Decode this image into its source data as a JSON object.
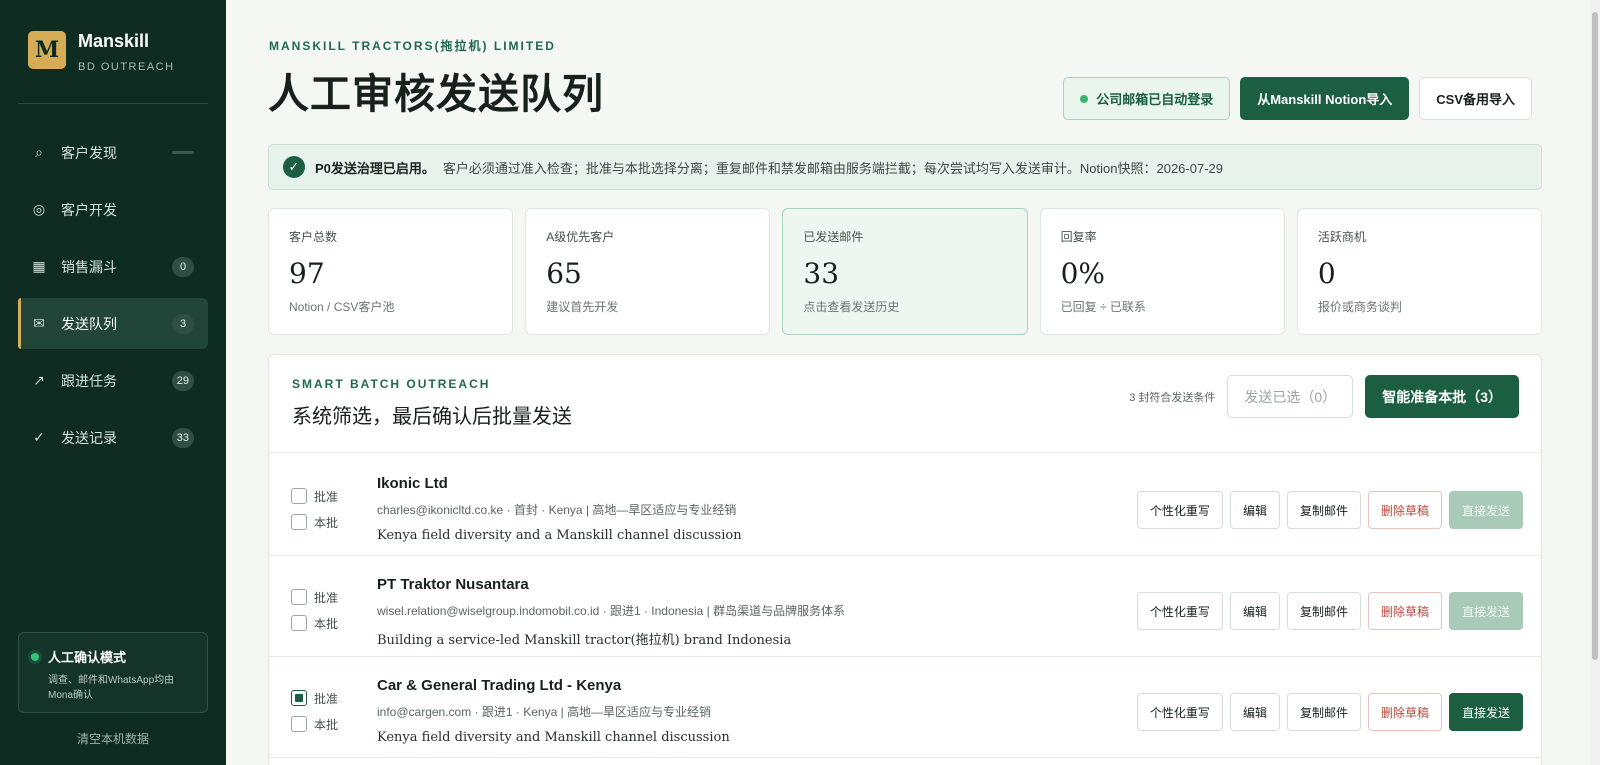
{
  "sidebar": {
    "logo_letter": "M",
    "brand_name": "Manskill",
    "brand_sub": "BD OUTREACH",
    "items": [
      {
        "label": "客户发现",
        "icon": "search-icon",
        "badge": ""
      },
      {
        "label": "客户开发",
        "icon": "target-icon",
        "badge": "0"
      },
      {
        "label": "销售漏斗",
        "icon": "grid-icon",
        "badge": "0"
      },
      {
        "label": "发送队列",
        "icon": "mail-icon",
        "badge": "3"
      },
      {
        "label": "跟进任务",
        "icon": "arrow-up-right-icon",
        "badge": "29"
      },
      {
        "label": "发送记录",
        "icon": "check-icon",
        "badge": "33"
      }
    ],
    "mode_title": "人工确认模式",
    "mode_desc": "调查、邮件和WhatsApp均由Mona确认",
    "clear_data": "清空本机数据"
  },
  "header": {
    "company": "MANSKILL TRACTORS(拖拉机) LIMITED",
    "title": "人工审核发送队列",
    "login_status": "公司邮箱已自动登录",
    "import_notion": "从Manskill Notion导入",
    "import_csv": "CSV备用导入"
  },
  "notice": {
    "strong": "P0发送治理已启用。",
    "text": "客户必须通过准入检查；批准与本批选择分离；重复邮件和禁发邮箱由服务端拦截；每次尝试均写入发送审计。Notion快照：2026-07-29"
  },
  "stats": [
    {
      "label": "客户总数",
      "value": "97",
      "sub": "Notion / CSV客户池"
    },
    {
      "label": "A级优先客户",
      "value": "65",
      "sub": "建议首先开发"
    },
    {
      "label": "已发送邮件",
      "value": "33",
      "sub": "点击查看发送历史"
    },
    {
      "label": "回复率",
      "value": "0%",
      "sub": "已回复 ÷ 已联系"
    },
    {
      "label": "活跃商机",
      "value": "0",
      "sub": "报价或商务谈判"
    }
  ],
  "batch": {
    "kicker": "SMART BATCH OUTREACH",
    "title": "系统筛选，最后确认后批量发送",
    "eligible": "3 封符合发送条件",
    "send_selected": "发送已选（0）",
    "smart_prepare": "智能准备本批（3）",
    "labels": {
      "approve": "批准",
      "this_batch": "本批",
      "rewrite": "个性化重写",
      "edit": "编辑",
      "copy": "复制邮件",
      "delete": "删除草稿",
      "send": "直接发送"
    },
    "rows": [
      {
        "name": "Ikonic Ltd",
        "meta": "charles@ikonicltd.co.ke · 首封 · Kenya | 高地—旱区适应与专业经销",
        "subject": "Kenya field diversity and a Manskill channel discussion"
      },
      {
        "name": "PT Traktor Nusantara",
        "meta": "wisel.relation@wiselgroup.indomobil.co.id · 跟进1 · Indonesia | 群岛渠道与品牌服务体系",
        "subject": "Building a service-led Manskill tractor(拖拉机) brand Indonesia"
      },
      {
        "name": "Car & General Trading Ltd - Kenya",
        "meta": "info@cargen.com · 跟进1 · Kenya | 高地—旱区适应与专业经销",
        "subject": "Kenya field diversity and Manskill channel discussion"
      }
    ]
  }
}
